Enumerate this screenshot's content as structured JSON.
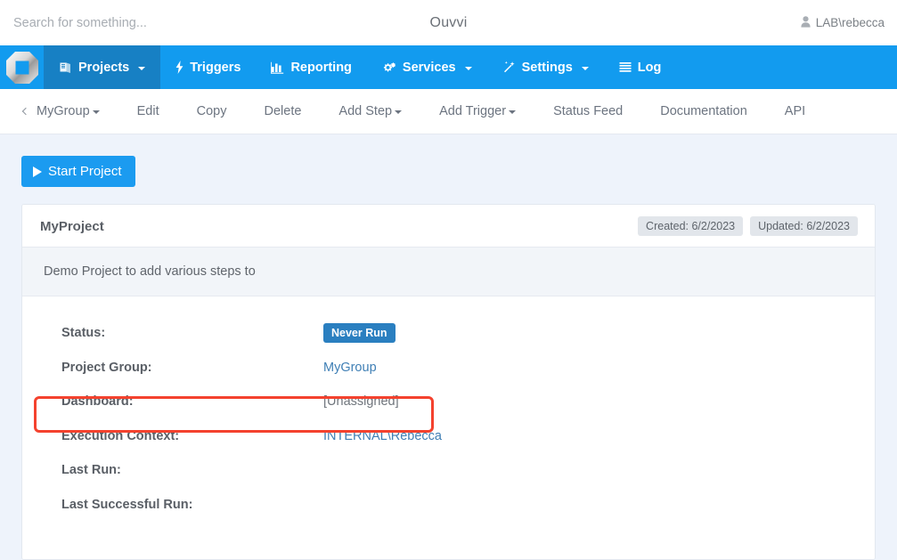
{
  "topbar": {
    "search_placeholder": "Search for something...",
    "search_value": "",
    "app_title": "Ouvvi",
    "user_label": "LAB\\rebecca",
    "user_icon": "user-icon"
  },
  "mainnav": {
    "logo_icon": "ouvvi-logo-icon",
    "items": [
      {
        "label": "Projects",
        "icon": "book-icon",
        "caret": true,
        "active": true
      },
      {
        "label": "Triggers",
        "icon": "bolt-icon",
        "caret": false,
        "active": false
      },
      {
        "label": "Reporting",
        "icon": "bar-chart-icon",
        "caret": false,
        "active": false
      },
      {
        "label": "Services",
        "icon": "gears-icon",
        "caret": true,
        "active": false
      },
      {
        "label": "Settings",
        "icon": "magic-wand-icon",
        "caret": true,
        "active": false
      },
      {
        "label": "Log",
        "icon": "list-icon",
        "caret": false,
        "active": false
      }
    ]
  },
  "subnav": {
    "items": [
      {
        "label": "MyGroup",
        "back": true,
        "caret": true
      },
      {
        "label": "Edit",
        "back": false,
        "caret": false
      },
      {
        "label": "Copy",
        "back": false,
        "caret": false
      },
      {
        "label": "Delete",
        "back": false,
        "caret": false
      },
      {
        "label": "Add Step",
        "back": false,
        "caret": true
      },
      {
        "label": "Add Trigger",
        "back": false,
        "caret": true
      },
      {
        "label": "Status Feed",
        "back": false,
        "caret": false
      },
      {
        "label": "Documentation",
        "back": false,
        "caret": false
      },
      {
        "label": "API",
        "back": false,
        "caret": false
      }
    ]
  },
  "content": {
    "start_button_label": "Start Project",
    "project_name": "MyProject",
    "created_badge": "Created: 6/2/2023",
    "updated_badge": "Updated: 6/2/2023",
    "description": "Demo Project to add various steps to",
    "details": [
      {
        "label": "Status:",
        "value": "Never Run",
        "kind": "badge"
      },
      {
        "label": "Project Group:",
        "value": "MyGroup",
        "kind": "link"
      },
      {
        "label": "Dashboard:",
        "value": "[Unassigned]",
        "kind": "text"
      },
      {
        "label": "Execution Context:",
        "value": "INTERNAL\\Rebecca",
        "kind": "link"
      },
      {
        "label": "Last Run:",
        "value": "",
        "kind": "text"
      },
      {
        "label": "Last Successful Run:",
        "value": "",
        "kind": "text"
      }
    ]
  },
  "annotation": {
    "target": "execution-context-row",
    "color": "#f4422e"
  },
  "colors": {
    "nav_blue": "#129bef",
    "nav_active_blue": "#1780c4",
    "button_blue": "#1b9bf0",
    "status_badge_blue": "#2a7fc0",
    "link_blue": "#3f7fb5",
    "page_bg": "#eef3fb",
    "annotation_red": "#f4422e"
  }
}
